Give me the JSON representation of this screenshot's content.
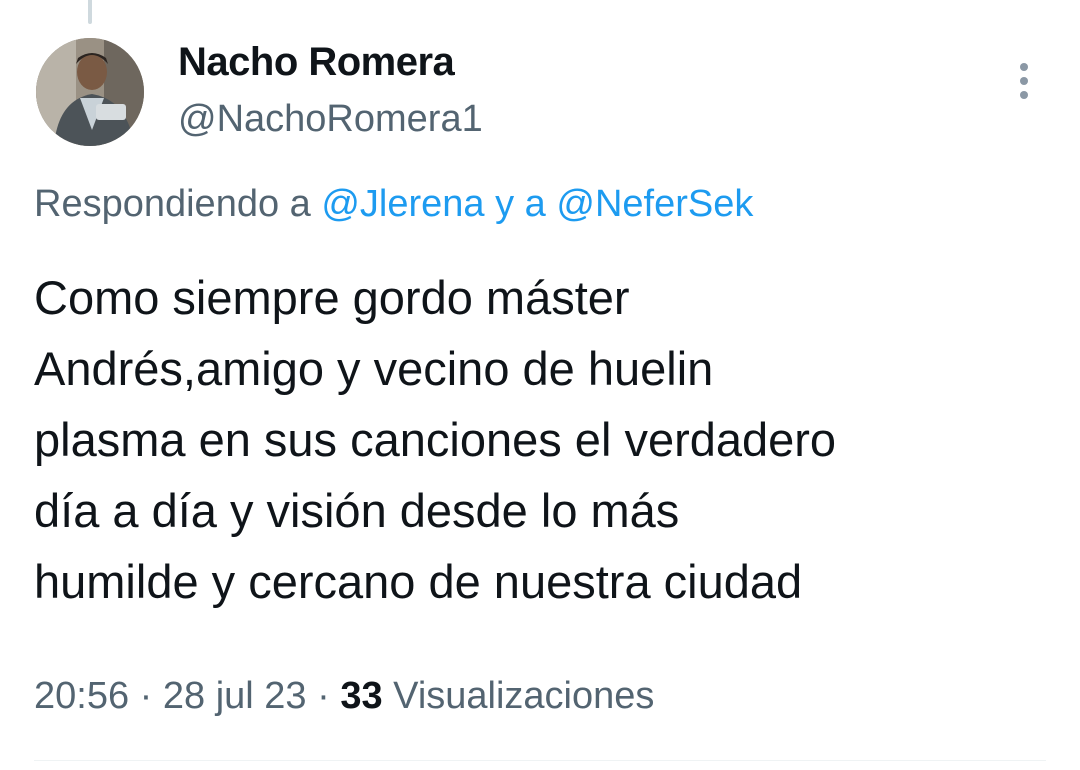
{
  "tweet": {
    "author": {
      "name": "Nacho Romera",
      "handle": "@NachoRomera1"
    },
    "reply_context": {
      "prefix": "Respondiendo a",
      "first_mention": "@Jlerena",
      "connector": "y a",
      "second_mention": "@NeferSek"
    },
    "text": "Como siempre gordo máster\nAndrés,amigo y vecino de huelin\nplasma en sus canciones el verdadero\ndía a día y visión desde lo más\nhumilde y cercano de nuestra ciudad",
    "meta": {
      "time": "20:56",
      "separator": "·",
      "date": "28 jul 23",
      "views_count": "33",
      "views_label": "Visualizaciones"
    }
  },
  "icons": {
    "more": "more-vertical-icon"
  },
  "colors": {
    "text_primary": "#0f1419",
    "text_secondary": "#536471",
    "link": "#1d9bf0",
    "thread_line": "#cfd9de"
  }
}
